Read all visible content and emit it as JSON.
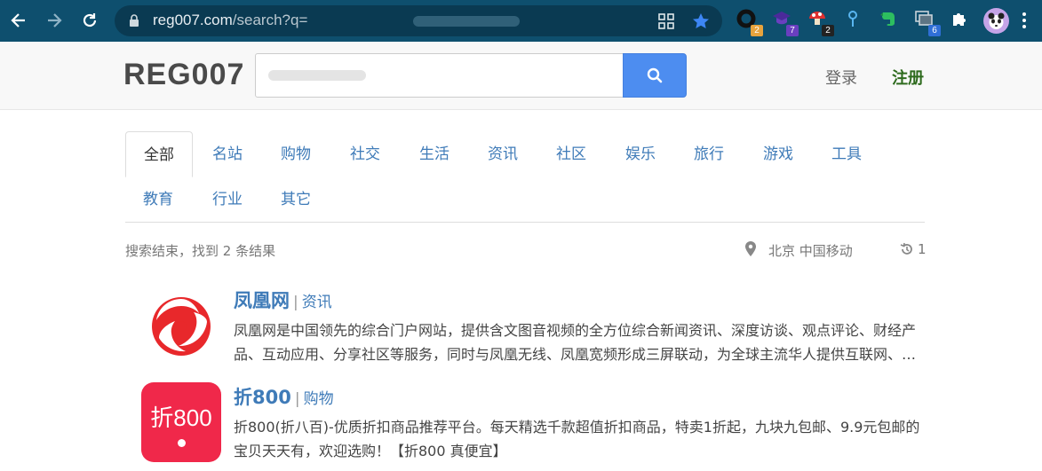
{
  "browser": {
    "url_host": "reg007.com",
    "url_path": "/search?q=",
    "extensions": [
      {
        "icon": "ring-extension-icon",
        "badge": "2",
        "badge_color": "#e8a33d"
      },
      {
        "icon": "graduation-cap-extension-icon",
        "badge": "7",
        "badge_color": "#6a3fc0"
      },
      {
        "icon": "mushroom-extension-icon",
        "badge": "2",
        "badge_color": "#222222"
      },
      {
        "icon": "pin-extension-icon",
        "badge": "",
        "badge_color": ""
      },
      {
        "icon": "evernote-extension-icon",
        "badge": "",
        "badge_color": ""
      },
      {
        "icon": "tabs-extension-icon",
        "badge": "6",
        "badge_color": "#2f6fd6"
      },
      {
        "icon": "puzzle-extensions-icon",
        "badge": "",
        "badge_color": ""
      }
    ]
  },
  "header": {
    "logo": "REG007",
    "search_value": "",
    "login": "登录",
    "register": "注册",
    "accent_color": "#4d8df0"
  },
  "tabs": [
    "全部",
    "名站",
    "购物",
    "社交",
    "生活",
    "资讯",
    "社区",
    "娱乐",
    "旅行",
    "游戏",
    "工具",
    "教育",
    "行业",
    "其它"
  ],
  "active_tab": "全部",
  "summary": {
    "text": "搜索结束，找到 2 条结果",
    "location": "北京 中国移动",
    "history_count": "1"
  },
  "results": [
    {
      "name": "凤凰网",
      "category": "资讯",
      "description": "凤凰网是中国领先的综合门户网站，提供含文图音视频的全方位综合新闻资讯、深度访谈、观点评论、财经产品、互动应用、分享社区等服务，同时与凤凰无线、凤凰宽频形成三屏联动，为全球主流华人提供互联网、无线通信、电视网三网融合无缝衔接的新媒体优质体验。",
      "logo_color": "#e8282b"
    },
    {
      "name": "折800",
      "category": "购物",
      "description": "折800(折八百)-优质折扣商品推荐平台。每天精选千款超值折扣商品，特卖1折起，九块九包邮、9.9元包邮的宝贝天天有，欢迎选购！【折800 真便宜】",
      "logo_text": "折800",
      "logo_color": "#f0284a"
    }
  ]
}
